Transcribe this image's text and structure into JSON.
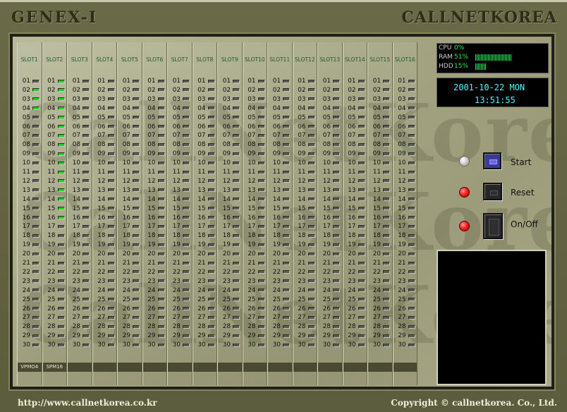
{
  "header": {
    "left_title": "GENEX-I",
    "right_title": "CALLNETKOREA"
  },
  "watermark": [
    "CallNetKorea",
    "CallNetKorea",
    "CallNetKorea"
  ],
  "slots": [
    {
      "label": "SLOT1",
      "card": "VPMO4",
      "active_ports": [
        2,
        3,
        4
      ]
    },
    {
      "label": "SLOT2",
      "card": "SPM16",
      "active_ports": [
        1,
        2,
        3,
        4,
        5,
        6,
        7,
        8,
        9,
        10,
        11,
        12,
        13,
        14,
        15,
        16
      ]
    },
    {
      "label": "SLOT3",
      "card": "",
      "active_ports": []
    },
    {
      "label": "SLOT4",
      "card": "",
      "active_ports": []
    },
    {
      "label": "SLOT5",
      "card": "",
      "active_ports": []
    },
    {
      "label": "SLOT6",
      "card": "",
      "active_ports": []
    },
    {
      "label": "SLOT7",
      "card": "",
      "active_ports": []
    },
    {
      "label": "SLOT8",
      "card": "",
      "active_ports": []
    },
    {
      "label": "SLOT9",
      "card": "",
      "active_ports": []
    },
    {
      "label": "SLOT10",
      "card": "",
      "active_ports": []
    },
    {
      "label": "SLOT11",
      "card": "",
      "active_ports": []
    },
    {
      "label": "SLOT12",
      "card": "",
      "active_ports": []
    },
    {
      "label": "SLOT13",
      "card": "",
      "active_ports": []
    },
    {
      "label": "SLOT14",
      "card": "",
      "active_ports": []
    },
    {
      "label": "SLOT15",
      "card": "",
      "active_ports": []
    },
    {
      "label": "SLOT16",
      "card": "",
      "active_ports": []
    }
  ],
  "port_labels": [
    "01",
    "02",
    "03",
    "04",
    "05",
    "06",
    "07",
    "08",
    "09",
    "10",
    "11",
    "12",
    "13",
    "14",
    "15",
    "16",
    "17",
    "18",
    "19",
    "20",
    "21",
    "22",
    "23",
    "24",
    "25",
    "26",
    "27",
    "28",
    "29",
    "30"
  ],
  "system": {
    "cpu": {
      "label": "CPU",
      "value": "0%",
      "bars": 0
    },
    "ram": {
      "label": "RAM",
      "value": "51%",
      "bars": 26
    },
    "hdd": {
      "label": "HDD",
      "value": "15%",
      "bars": 8
    }
  },
  "clock": {
    "date": "2001-10-22  MON",
    "time": "13:51:55"
  },
  "controls": {
    "start": "Start",
    "reset": "Reset",
    "onoff": "On/Off"
  },
  "footer": {
    "url": "http://www.callnetkorea.co.kr",
    "copyright": "Copyright © callnetkorea. Co., Ltd."
  },
  "colors": {
    "led_on": "#16d81f",
    "led_off": "#5b5b55",
    "accent_green": "#21ef55",
    "clock_cyan": "#59f2ff"
  }
}
